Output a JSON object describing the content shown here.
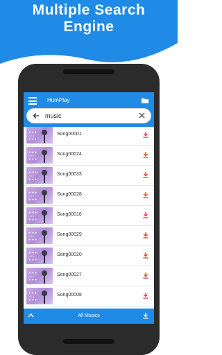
{
  "hero": {
    "title_line1": "Multiple Search",
    "title_line2": "Engine"
  },
  "app": {
    "title": "HumPlay",
    "search": {
      "value": "music"
    },
    "songs": [
      "Song00001",
      "Song00024",
      "Song00033",
      "Song00028",
      "Song00016",
      "Song00029",
      "Song00020",
      "Song00027",
      "Song00008"
    ],
    "bottom_label": "All Musics"
  },
  "colors": {
    "primary": "#1f8be6",
    "download": "#e53935"
  }
}
